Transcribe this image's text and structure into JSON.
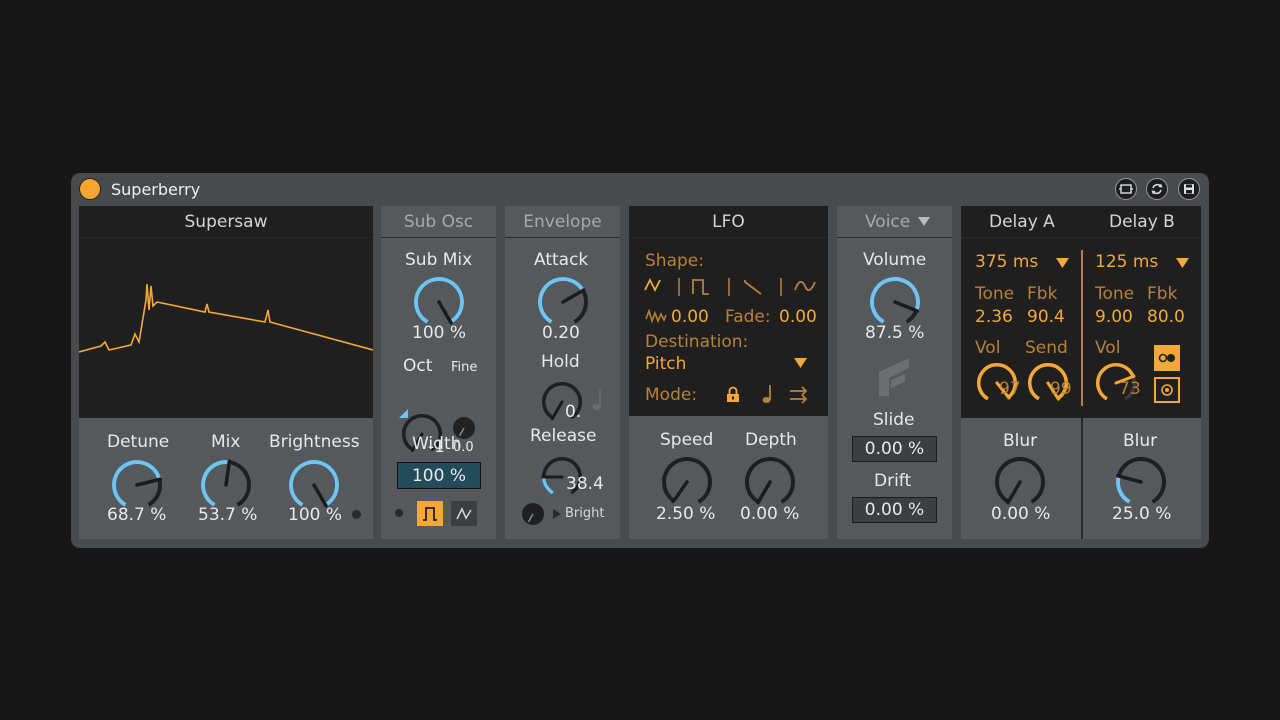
{
  "device": {
    "title": "Superberry",
    "icons": [
      "hot-swap-icon",
      "refresh-icon",
      "save-icon"
    ]
  },
  "supersaw": {
    "header": "Supersaw",
    "detune": {
      "label": "Detune",
      "value": "68.7 %"
    },
    "mix": {
      "label": "Mix",
      "value": "53.7 %"
    },
    "brightness": {
      "label": "Brightness",
      "value": "100 %"
    }
  },
  "subosc": {
    "header": "Sub Osc",
    "submix": {
      "label": "Sub Mix",
      "value": "100 %"
    },
    "oct": {
      "label": "Oct",
      "value": "-1"
    },
    "fine": {
      "label": "Fine",
      "value": "0.0"
    },
    "width": {
      "label": "Width",
      "value": "100 %"
    }
  },
  "envelope": {
    "header": "Envelope",
    "attack": {
      "label": "Attack",
      "value": "0.20"
    },
    "hold": {
      "label": "Hold",
      "value": "0."
    },
    "release": {
      "label": "Release",
      "value": "38.4"
    },
    "bright_label": "Bright"
  },
  "lfo": {
    "header": "LFO",
    "shape_label": "Shape:",
    "wave_value": "0.00",
    "fade_label": "Fade:",
    "fade_value": "0.00",
    "destination_label": "Destination:",
    "destination_value": "Pitch",
    "mode_label": "Mode:",
    "speed": {
      "label": "Speed",
      "value": "2.50 %"
    },
    "depth": {
      "label": "Depth",
      "value": "0.00 %"
    }
  },
  "voice": {
    "header": "Voice",
    "volume": {
      "label": "Volume",
      "value": "87.5 %"
    },
    "slide": {
      "label": "Slide",
      "value": "0.00 %"
    },
    "drift": {
      "label": "Drift",
      "value": "0.00 %"
    }
  },
  "delay": {
    "a": {
      "header": "Delay A",
      "time": "375 ms",
      "tone_label": "Tone",
      "tone_value": "2.36",
      "fbk_label": "Fbk",
      "fbk_value": "90.4",
      "vol_label": "Vol",
      "vol_value": "97",
      "send_label": "Send",
      "send_value": "99",
      "blur": {
        "label": "Blur",
        "value": "0.00 %"
      }
    },
    "b": {
      "header": "Delay B",
      "time": "125 ms",
      "tone_label": "Tone",
      "tone_value": "9.00",
      "fbk_label": "Fbk",
      "fbk_value": "80.0",
      "vol_label": "Vol",
      "vol_value": "73",
      "blur": {
        "label": "Blur",
        "value": "25.0 %"
      }
    }
  },
  "colors": {
    "accent": "#f5a837",
    "knob_blue": "#6ec4f2",
    "panel": "#55595c",
    "display": "#1f1f1f"
  }
}
